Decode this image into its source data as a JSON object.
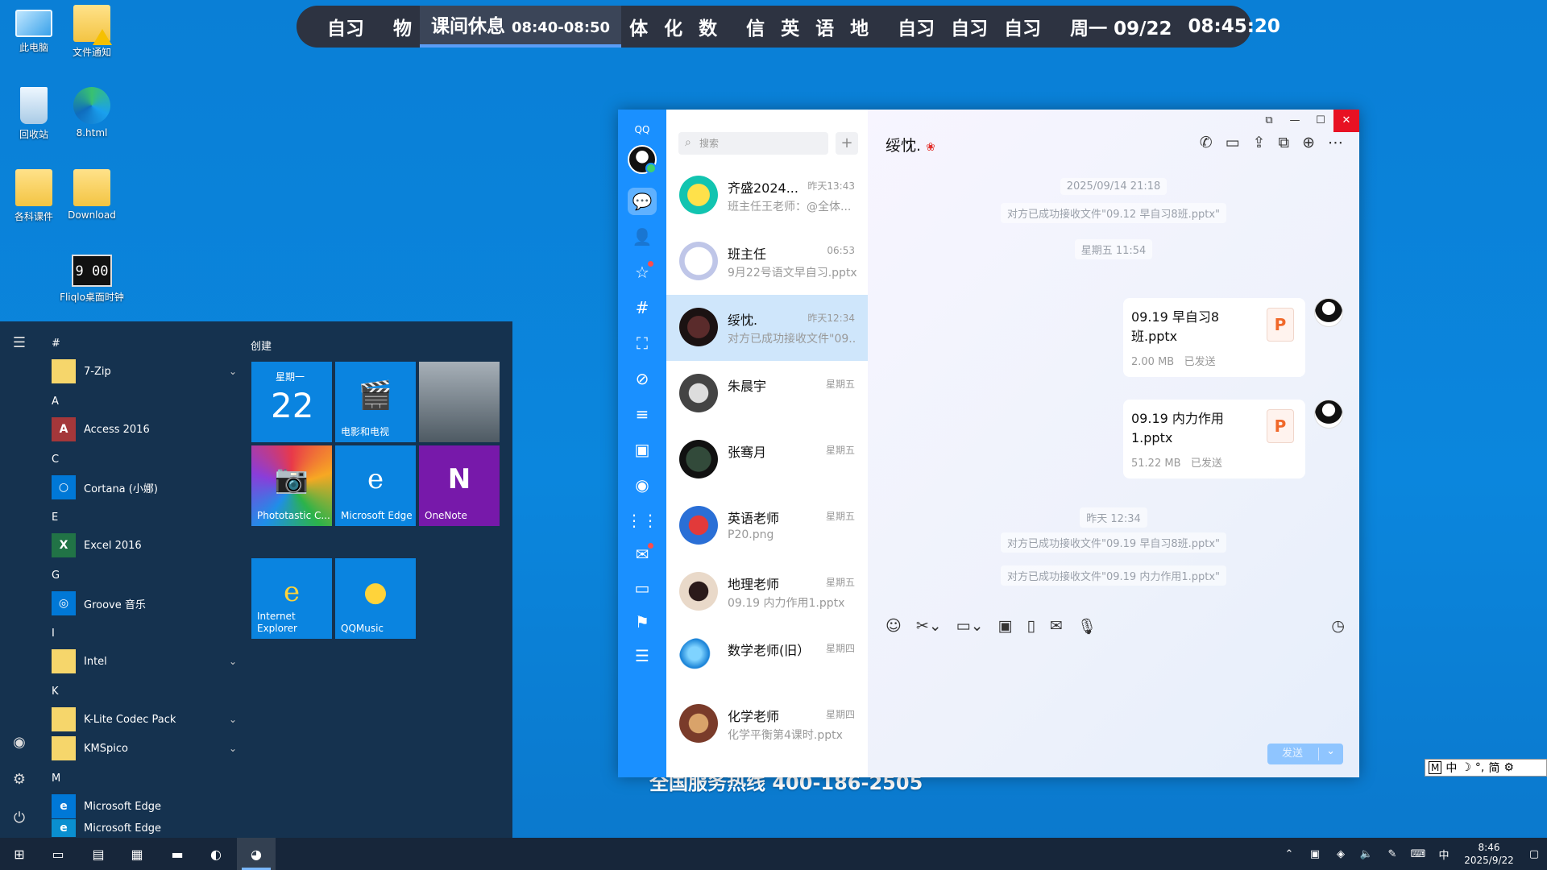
{
  "desktop": {
    "icons": [
      {
        "label": "此电脑"
      },
      {
        "label": "文件通知"
      },
      {
        "label": "回收站"
      },
      {
        "label": "8.html"
      },
      {
        "label": "各科课件"
      },
      {
        "label": "Download"
      },
      {
        "label": "Fliqlo桌面时钟"
      }
    ],
    "clock_icon_text": "9 00",
    "hotline": "全国服务热线 400-186-2505"
  },
  "schedule": {
    "items": [
      "自习",
      "物",
      "体",
      "化",
      "数",
      "信",
      "英",
      "语",
      "地",
      "自习",
      "自习",
      "自习"
    ],
    "current_label": "课间休息",
    "current_time": "08:40-08:50",
    "date": "周一 09/22",
    "time": "08:45:20"
  },
  "qq": {
    "logo": "QQ",
    "search_placeholder": "搜索",
    "add_label": "+",
    "conversations": [
      {
        "name": "齐盛2024...",
        "time": "昨天13:43",
        "preview": "班主任王老师：@全体..."
      },
      {
        "name": "班主任",
        "time": "06:53",
        "preview": "9月22号语文早自习.pptx"
      },
      {
        "name": "绥忱.",
        "time": "昨天12:34",
        "preview": "对方已成功接收文件\"09..."
      },
      {
        "name": "朱晨宇",
        "time": "星期五",
        "preview": ""
      },
      {
        "name": "张骞月",
        "time": "星期五",
        "preview": ""
      },
      {
        "name": "英语老师",
        "time": "星期五",
        "preview": "P20.png"
      },
      {
        "name": "地理老师",
        "time": "星期五",
        "preview": "09.19 内力作用1.pptx"
      },
      {
        "name": "数学老师(旧）",
        "time": "星期四",
        "preview": ""
      },
      {
        "name": "化学老师",
        "time": "星期四",
        "preview": "化学平衡第4课时.pptx"
      }
    ],
    "chat": {
      "title": "绥忱.",
      "messages": [
        {
          "time": "2025/09/14 21:18"
        },
        {
          "system": "对方已成功接收文件\"09.12 早自习8班.pptx\""
        },
        {
          "time": "星期五 11:54"
        },
        {
          "file": "09.19 早自习8班.pptx",
          "size": "2.00 MB",
          "status": "已发送"
        },
        {
          "file": "09.19 内力作用1.pptx",
          "size": "51.22 MB",
          "status": "已发送"
        },
        {
          "time": "昨天 12:34"
        },
        {
          "system": "对方已成功接收文件\"09.19 早自习8班.pptx\""
        },
        {
          "system": "对方已成功接收文件\"09.19 内力作用1.pptx\""
        }
      ],
      "send_label": "发送"
    }
  },
  "start_menu": {
    "tiles_group": "创建",
    "apps": [
      {
        "letter": "#",
        "name": "7-Zip"
      },
      {
        "letter": "A",
        "name": "Access 2016"
      },
      {
        "letter": "C",
        "name": "Cortana (小娜)"
      },
      {
        "letter": "E",
        "name": "Excel 2016"
      },
      {
        "letter": "G",
        "name": "Groove 音乐"
      },
      {
        "letter": "I",
        "name": "Intel"
      },
      {
        "letter": "K",
        "name": "K-Lite Codec Pack"
      },
      {
        "letter": "",
        "name": "KMSpico"
      },
      {
        "letter": "M",
        "name": "Microsoft Edge"
      },
      {
        "letter": "",
        "name": "Microsoft Edge"
      }
    ],
    "tiles": {
      "calendar_day": "星期一",
      "calendar_date": "22",
      "movies": "电影和电视",
      "phototastic": "Phototastic C...",
      "edge": "Microsoft Edge",
      "onenote": "OneNote",
      "ie": "Internet Explorer",
      "qqmusic": "QQMusic"
    }
  },
  "taskbar": {
    "time": "8:46",
    "date": "2025/9/22",
    "ime": "中"
  },
  "ime_bar": {
    "mode": "M",
    "lang": "中",
    "simp": "简"
  }
}
